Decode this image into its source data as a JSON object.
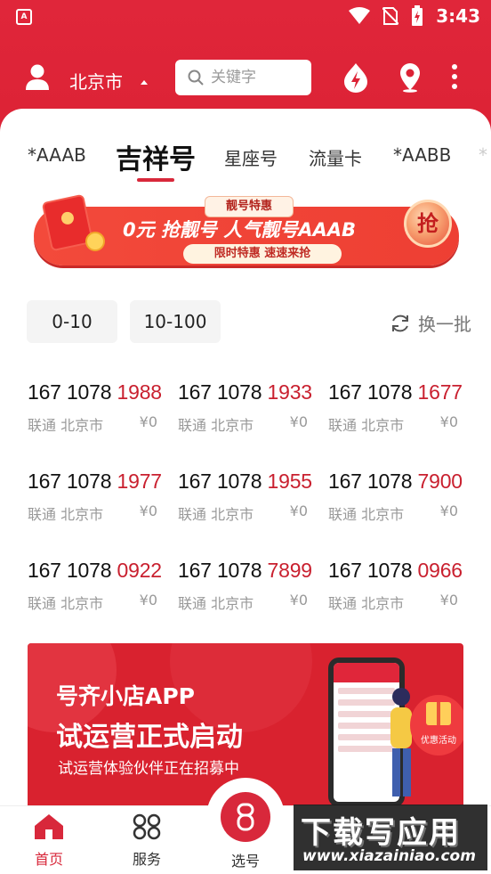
{
  "status_bar": {
    "time": "3:43"
  },
  "header": {
    "city": "北京市",
    "search_placeholder": "关键字"
  },
  "tabs": [
    {
      "label": "*AAAB",
      "active": false
    },
    {
      "label": "吉祥号",
      "active": true
    },
    {
      "label": "星座号",
      "active": false
    },
    {
      "label": "流量卡",
      "active": false
    },
    {
      "label": "*AABB",
      "active": false
    }
  ],
  "banner": {
    "tag": "靓号特惠",
    "main": "0元 抢靓号  人气靓号AAAB",
    "sub": "限时特惠  速速来抢",
    "grab": "抢"
  },
  "filters": {
    "ranges": [
      "0-10",
      "10-100"
    ],
    "refresh": "换一批"
  },
  "numbers": [
    {
      "prefix": "167 1078 ",
      "tail": "1988",
      "carrier": "联通",
      "city": "北京市",
      "price": "¥0"
    },
    {
      "prefix": "167 1078 ",
      "tail": "1933",
      "carrier": "联通",
      "city": "北京市",
      "price": "¥0"
    },
    {
      "prefix": "167 1078 ",
      "tail": "1677",
      "carrier": "联通",
      "city": "北京市",
      "price": "¥0"
    },
    {
      "prefix": "167 1078 ",
      "tail": "1977",
      "carrier": "联通",
      "city": "北京市",
      "price": "¥0"
    },
    {
      "prefix": "167 1078 ",
      "tail": "1955",
      "carrier": "联通",
      "city": "北京市",
      "price": "¥0"
    },
    {
      "prefix": "167 1078 ",
      "tail": "7900",
      "carrier": "联通",
      "city": "北京市",
      "price": "¥0"
    },
    {
      "prefix": "167 1078 ",
      "tail": "0922",
      "carrier": "联通",
      "city": "北京市",
      "price": "¥0"
    },
    {
      "prefix": "167 1078 ",
      "tail": "7899",
      "carrier": "联通",
      "city": "北京市",
      "price": "¥0"
    },
    {
      "prefix": "167 1078 ",
      "tail": "0966",
      "carrier": "联通",
      "city": "北京市",
      "price": "¥0"
    }
  ],
  "promo": {
    "title1": "号齐小店APP",
    "title2": "试运营正式启动",
    "subtitle": "试运营体验伙伴正在招募中",
    "badge": "优惠活动"
  },
  "tabbar": {
    "home": "首页",
    "service": "服务",
    "select": "选号"
  },
  "watermark": {
    "title": "下载写应用",
    "url": "www.xiazainiao.com"
  },
  "colors": {
    "brand_red": "#d8283b",
    "number_highlight": "#c9202f"
  }
}
